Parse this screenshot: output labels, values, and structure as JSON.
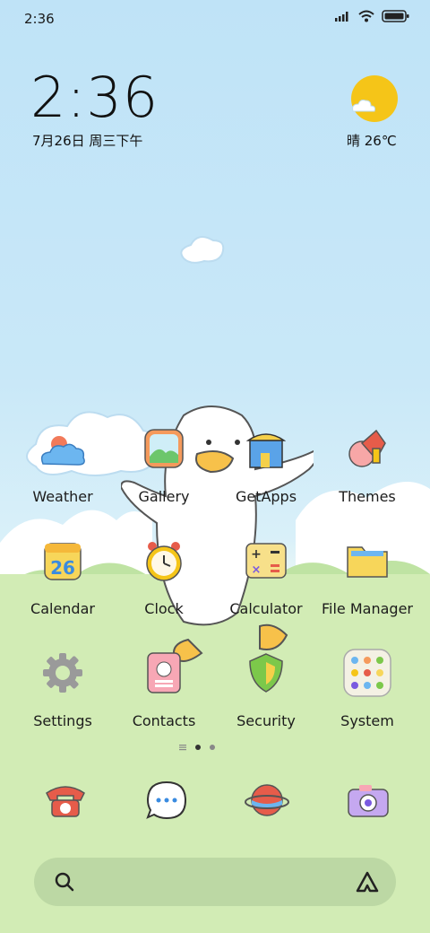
{
  "status_bar": {
    "time": "2:36"
  },
  "clock_widget": {
    "time": "2:36",
    "date": "7月26日 周三下午"
  },
  "weather_widget": {
    "condition_temp": "晴 26℃"
  },
  "apps": [
    {
      "label": "Weather",
      "icon": "weather-icon"
    },
    {
      "label": "Gallery",
      "icon": "gallery-icon"
    },
    {
      "label": "GetApps",
      "icon": "getapps-icon"
    },
    {
      "label": "Themes",
      "icon": "themes-icon"
    },
    {
      "label": "Calendar",
      "icon": "calendar-icon",
      "badge": "26"
    },
    {
      "label": "Clock",
      "icon": "clock-icon"
    },
    {
      "label": "Calculator",
      "icon": "calculator-icon"
    },
    {
      "label": "File Manager",
      "icon": "file-manager-icon"
    },
    {
      "label": "Settings",
      "icon": "settings-icon"
    },
    {
      "label": "Contacts",
      "icon": "contacts-icon"
    },
    {
      "label": "Security",
      "icon": "security-icon"
    },
    {
      "label": "System",
      "icon": "system-folder-icon"
    }
  ],
  "dock": [
    "phone-icon",
    "messages-icon",
    "browser-icon",
    "camera-icon"
  ],
  "page_indicator": {
    "pages": 2,
    "current": 1
  },
  "colors": {
    "sky": "#c9e8f8",
    "grass": "#d2ecb5",
    "sun": "#f5c518"
  }
}
